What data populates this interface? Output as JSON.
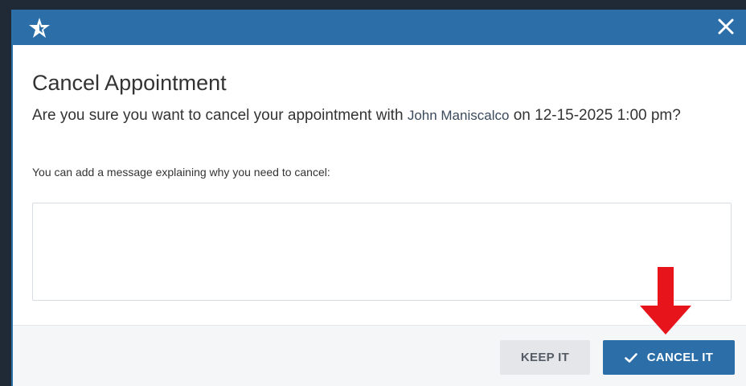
{
  "dialog": {
    "title": "Cancel Appointment",
    "question_prefix": "Are you sure you want to cancel your appointment with ",
    "provider_name": "John Maniscalco",
    "question_suffix": " on 12-15-2025 1:00 pm?",
    "message_hint": "You can add a message explaining why you need to cancel:",
    "message_value": "",
    "message_placeholder": ""
  },
  "buttons": {
    "keep_label": "KEEP IT",
    "cancel_label": "CANCEL IT"
  },
  "icons": {
    "logo": "star-logo-icon",
    "close": "close-icon",
    "check": "check-icon",
    "annotation": "red-down-arrow"
  },
  "colors": {
    "header": "#2b6ea8",
    "primary_button": "#2b6ea8",
    "secondary_button": "#e4e6e9",
    "annotation_arrow": "#e8141b"
  }
}
